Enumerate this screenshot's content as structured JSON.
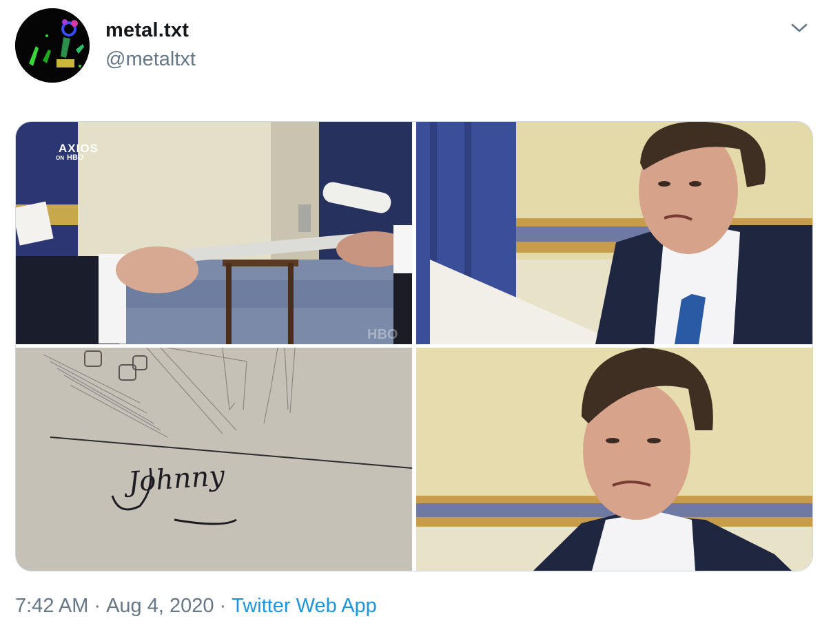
{
  "tweet": {
    "author": {
      "display_name": "metal.txt",
      "handle": "@metaltxt",
      "avatar_icon": "skeleton-avatar"
    },
    "menu_icon": "chevron-down-icon",
    "media": [
      {
        "alt": "",
        "watermarks": {
          "brand_top": "AXIOS",
          "brand_sub_on": "ON",
          "brand_sub_hbo": "HBO",
          "corner": "HBO"
        }
      },
      {
        "alt": ""
      },
      {
        "alt": "",
        "signature": "Johnny"
      },
      {
        "alt": ""
      }
    ],
    "time": "7:42 AM",
    "date": "Aug 4, 2020",
    "separator": "·",
    "source": "Twitter Web App"
  },
  "colors": {
    "text_primary": "#14171a",
    "text_secondary": "#657786",
    "link": "#1b95e0",
    "border": "#ccd6dd"
  }
}
